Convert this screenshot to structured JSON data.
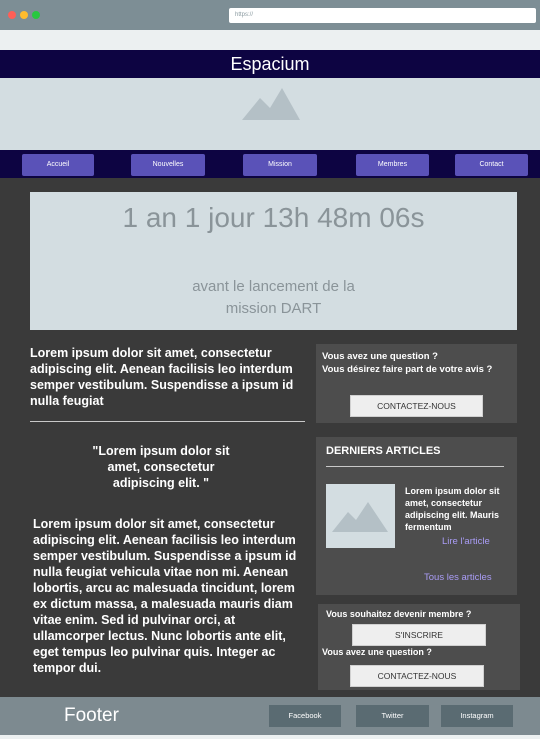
{
  "browser": {
    "url": "https://"
  },
  "header": {
    "title": "Espacium"
  },
  "nav": {
    "items": [
      {
        "label": "Accueil"
      },
      {
        "label": "Nouvelles"
      },
      {
        "label": "Mission"
      },
      {
        "label": "Membres"
      },
      {
        "label": "Contact"
      }
    ]
  },
  "countdown": {
    "time": "1 an 1 jour 13h 48m 06s",
    "label": "avant le lancement de la mission DART"
  },
  "main": {
    "lead": "Lorem ipsum dolor sit amet, consectetur adipiscing elit. Aenean facilisis leo interdum semper vestibulum. Suspendisse a ipsum id nulla feugiat",
    "quote": "\"Lorem ipsum dolor sit amet, consectetur adipiscing elit. \"",
    "body": "Lorem ipsum dolor sit amet, consectetur adipiscing elit. Aenean facilisis leo interdum semper vestibulum. Suspendisse a ipsum id nulla feugiat vehicula vitae non mi. Aenean lobortis, arcu ac malesuada tincidunt, lorem ex dictum massa, a malesuada mauris diam vitae enim. Sed id pulvinar orci, at ullamcorper lectus. Nunc lobortis ante elit, eget tempus leo pulvinar quis. Integer ac tempor dui."
  },
  "question_card": {
    "text_line1": "Vous avez une question ?",
    "text_line2": "Vous désirez faire part de votre avis ?",
    "button": "CONTACTEZ-NOUS"
  },
  "articles": {
    "title": "DERNIERS ARTICLES",
    "article_text": "Lorem ipsum dolor sit amet, consectetur adipiscing elit. Mauris fermentum",
    "read_link": "Lire l'article",
    "all_link": "Tous les articles"
  },
  "member_card": {
    "question1": "Vous souhaitez devenir membre ?",
    "signup_button": "S'INSCRIRE",
    "question2": "Vous avez une question ?",
    "contact_button": "CONTACTEZ-NOUS"
  },
  "footer": {
    "title": "Footer",
    "social": [
      {
        "label": "Facebook"
      },
      {
        "label": "Twitter"
      },
      {
        "label": "Instagram"
      }
    ]
  },
  "colors": {
    "header_bg": "#0d0442",
    "nav_button": "#5a52b8",
    "main_bg": "#3a3a3a",
    "card_bg": "#4d4d4d",
    "link": "#a99cf5",
    "footer_bg": "#7d8a90",
    "placeholder": "#d3dde1"
  }
}
